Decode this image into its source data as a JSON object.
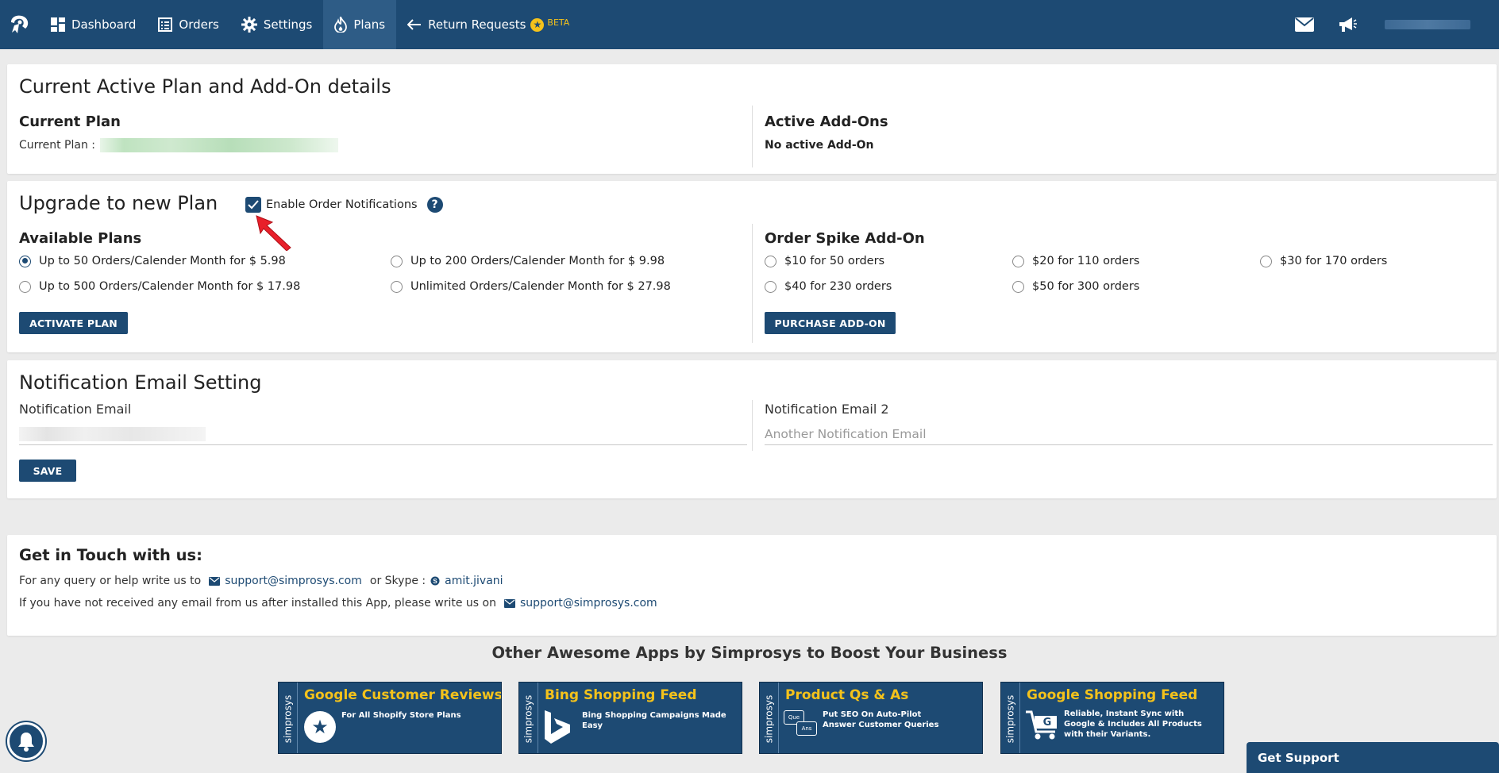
{
  "nav": {
    "items": [
      {
        "label": "Dashboard",
        "icon": "dashboard-icon"
      },
      {
        "label": "Orders",
        "icon": "orders-icon"
      },
      {
        "label": "Settings",
        "icon": "gear-icon"
      },
      {
        "label": "Plans",
        "icon": "fire-icon",
        "active": true
      },
      {
        "label": "Return Requests",
        "icon": "return-arrow-icon"
      }
    ],
    "beta_label": "BETA",
    "accent": "#1d4a73",
    "highlight": "#f4c21b"
  },
  "current_plan": {
    "title": "Current Active Plan and Add-On details",
    "plan_heading": "Current Plan",
    "plan_label": "Current Plan :",
    "addons_heading": "Active Add-Ons",
    "addons_value": "No active Add-On"
  },
  "upgrade": {
    "title": "Upgrade to new Plan",
    "notifications_label": "Enable Order Notifications",
    "notifications_checked": true,
    "plans_heading": "Available Plans",
    "plans": [
      {
        "label": "Up to 50 Orders/Calender Month for $ 5.98",
        "checked": true
      },
      {
        "label": "Up to 200 Orders/Calender Month for $ 9.98",
        "checked": false
      },
      {
        "label": "Up to 500 Orders/Calender Month for $ 17.98",
        "checked": false
      },
      {
        "label": "Unlimited Orders/Calender Month for $ 27.98",
        "checked": false
      }
    ],
    "activate_label": "ACTIVATE PLAN",
    "addon_heading": "Order Spike Add-On",
    "addons": [
      {
        "label": "$10 for 50 orders"
      },
      {
        "label": "$20 for 110 orders"
      },
      {
        "label": "$30 for 170 orders"
      },
      {
        "label": "$40 for 230 orders"
      },
      {
        "label": "$50 for 300 orders"
      }
    ],
    "purchase_label": "PURCHASE ADD-ON"
  },
  "notification": {
    "title": "Notification Email Setting",
    "email1_label": "Notification Email",
    "email2_label": "Notification Email 2",
    "email2_placeholder": "Another Notification Email",
    "save_label": "SAVE"
  },
  "contact": {
    "title": "Get in Touch with us:",
    "line1_prefix": "For any query or help write us to",
    "email": "support@simprosys.com",
    "skype_prefix": "or Skype :",
    "skype": "amit.jivani",
    "line2_prefix": "If you have not received any email from us after installed this App, please write us on",
    "email2": "support@simprosys.com"
  },
  "other_apps": {
    "title": "Other Awesome Apps by Simprosys to Boost Your Business",
    "brand": "simprosys",
    "apps": [
      {
        "title": "Google Customer Reviews",
        "desc": "For All Shopify Store Plans",
        "icon": "star-icon"
      },
      {
        "title": "Bing Shopping Feed",
        "desc": "Bing Shopping Campaigns Made Easy",
        "icon": "bing-icon"
      },
      {
        "title": "Product Qs & As",
        "desc": "Put SEO On Auto-Pilot\nAnswer Customer Queries",
        "icon": "qa-icon",
        "badge_q": "Que",
        "badge_a": "Ans"
      },
      {
        "title": "Google Shopping Feed",
        "desc": "Reliable, Instant Sync with\nGoogle & Includes All Products\nwith their Variants.",
        "icon": "cart-icon",
        "badge": "G"
      }
    ]
  },
  "support": {
    "label": "Get Support"
  }
}
